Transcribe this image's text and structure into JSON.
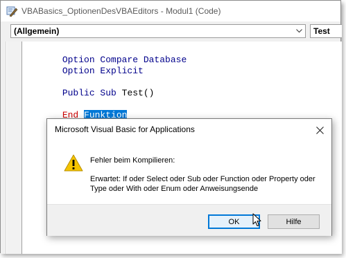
{
  "window": {
    "title": "VBABasics_OptionenDesVBAEditors - Modul1 (Code)",
    "icon": "vba-editor-icon"
  },
  "toolbar": {
    "object_combo_value": "(Allgemein)",
    "procedure_combo_value": "Test"
  },
  "code": {
    "lines": [
      {
        "kw": "Option Compare Database"
      },
      {
        "kw": "Option Explicit"
      },
      {
        "kw": "Public Sub ",
        "rest": "Test()"
      },
      {
        "kw": "End ",
        "selected": "Funktion"
      }
    ]
  },
  "dialog": {
    "title": "Microsoft Visual Basic for Applications",
    "heading": "Fehler beim Kompilieren:",
    "detail": "Erwartet: If oder Select oder Sub oder Function oder Property oder Type oder With oder Enum oder Anweisungsende",
    "ok_label": "OK",
    "help_label": "Hilfe",
    "icon": "warning-icon"
  },
  "colors": {
    "keyword": "#00008b",
    "error_keyword": "#cc0000",
    "selection": "#0078d7",
    "ok_border": "#0078d7"
  }
}
